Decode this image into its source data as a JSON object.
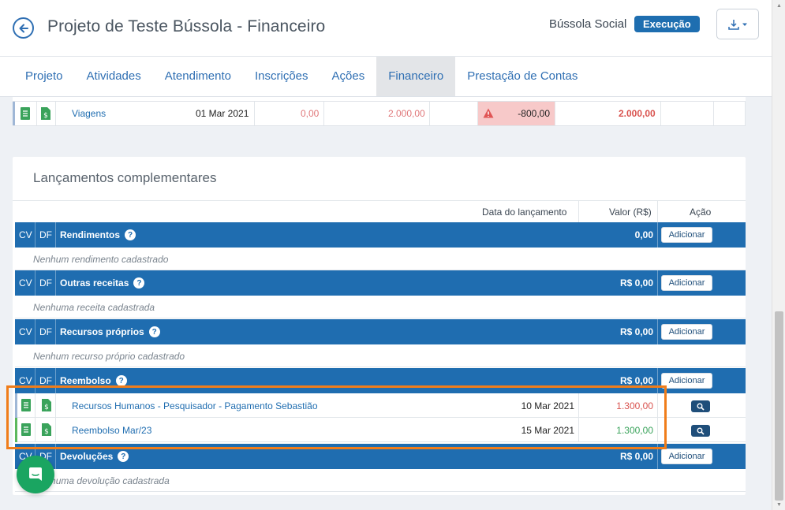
{
  "header": {
    "title": "Projeto de Teste Bússola - Financeiro",
    "org": "Bússola Social",
    "status": "Execução"
  },
  "tabs": [
    {
      "label": "Projeto"
    },
    {
      "label": "Atividades"
    },
    {
      "label": "Atendimento"
    },
    {
      "label": "Inscrições"
    },
    {
      "label": "Ações"
    },
    {
      "label": "Financeiro",
      "active": true
    },
    {
      "label": "Prestação de Contas"
    }
  ],
  "top_row": {
    "name": "Viagens",
    "date": "01 Mar 2021",
    "v1": "0,00",
    "v2": "2.000,00",
    "diff": "-800,00",
    "total": "2.000,00"
  },
  "section_card": {
    "title": "Lançamentos complementares",
    "col_date": "Data do lançamento",
    "col_value": "Valor (R$)",
    "col_action": "Ação",
    "cv": "CV",
    "df": "DF",
    "add_label": "Adicionar"
  },
  "sections": [
    {
      "title": "Rendimentos",
      "amount": "0,00",
      "empty": "Nenhum rendimento cadastrado"
    },
    {
      "title": "Outras receitas",
      "amount": "R$ 0,00",
      "empty": "Nenhuma receita cadastrada"
    },
    {
      "title": "Recursos próprios",
      "amount": "R$ 0,00",
      "empty": "Nenhum recurso próprio cadastrado"
    },
    {
      "title": "Reembolso",
      "amount": "R$ 0,00"
    },
    {
      "title": "Devoluções",
      "amount": "R$ 0,00",
      "empty": "Nenhuma devolução cadastrada"
    }
  ],
  "reembolso_entries": [
    {
      "desc": "Recursos Humanos - Pesquisador - Pagamento Sebastião",
      "date": "10 Mar 2021",
      "value": "1.300,00",
      "value_color": "#d9534f",
      "marker": "#9fb7d6"
    },
    {
      "desc": "Reembolso Mar/23",
      "date": "15 Mar 2021",
      "value": "1.300,00",
      "value_color": "#3aa35b",
      "marker": "#5cb85c"
    }
  ],
  "colors": {
    "primary": "#1f6db0",
    "highlight": "#f07d1a",
    "danger_bg": "#f7c9c9",
    "chat": "#1aa561"
  }
}
